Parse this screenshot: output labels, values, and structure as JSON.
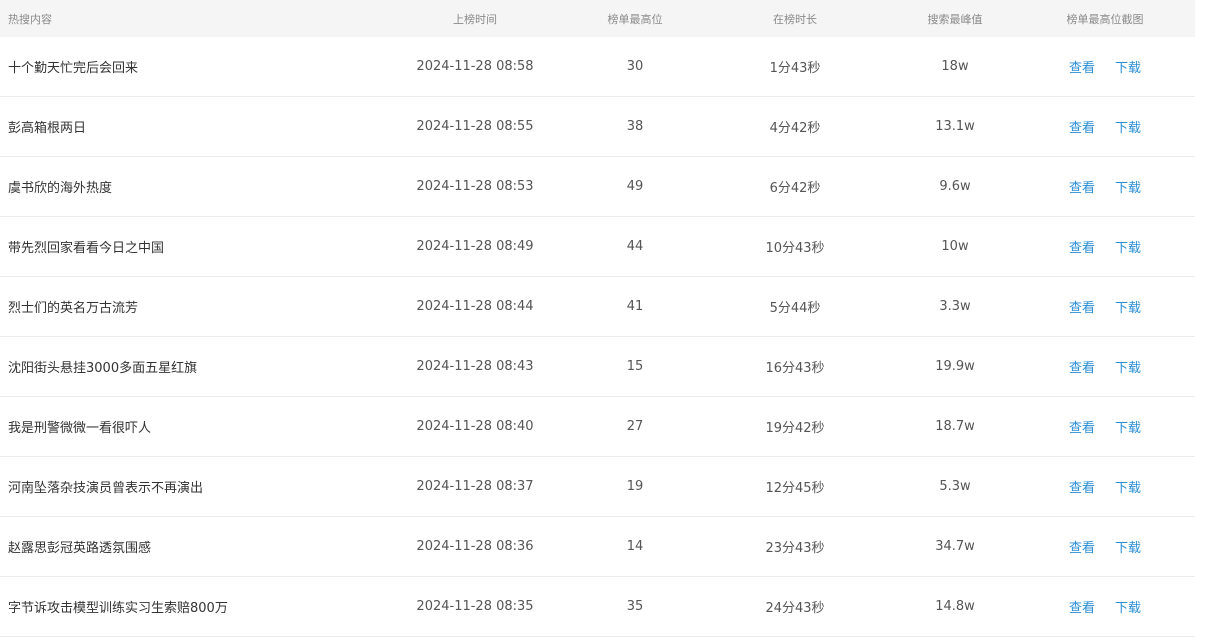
{
  "header": {
    "title": "热搜内容",
    "time": "上榜时间",
    "highest_rank": "榜单最高位",
    "duration": "在榜时长",
    "peak": "搜索最峰值",
    "screenshot": "榜单最高位截图"
  },
  "actions": {
    "view": "查看",
    "download": "下载"
  },
  "colors": {
    "link": "#2b8ed3",
    "header_bg": "#f5f5f5"
  },
  "rows": [
    {
      "title": "十个勤天忙完后会回来",
      "time": "2024-11-28 08:58",
      "rank": "30",
      "duration": "1分43秒",
      "peak": "18w"
    },
    {
      "title": "彭高箱根两日",
      "time": "2024-11-28 08:55",
      "rank": "38",
      "duration": "4分42秒",
      "peak": "13.1w"
    },
    {
      "title": "虞书欣的海外热度",
      "time": "2024-11-28 08:53",
      "rank": "49",
      "duration": "6分42秒",
      "peak": "9.6w"
    },
    {
      "title": "带先烈回家看看今日之中国",
      "time": "2024-11-28 08:49",
      "rank": "44",
      "duration": "10分43秒",
      "peak": "10w"
    },
    {
      "title": "烈士们的英名万古流芳",
      "time": "2024-11-28 08:44",
      "rank": "41",
      "duration": "5分44秒",
      "peak": "3.3w"
    },
    {
      "title": "沈阳街头悬挂3000多面五星红旗",
      "time": "2024-11-28 08:43",
      "rank": "15",
      "duration": "16分43秒",
      "peak": "19.9w"
    },
    {
      "title": "我是刑警微微一看很吓人",
      "time": "2024-11-28 08:40",
      "rank": "27",
      "duration": "19分42秒",
      "peak": "18.7w"
    },
    {
      "title": "河南坠落杂技演员曾表示不再演出",
      "time": "2024-11-28 08:37",
      "rank": "19",
      "duration": "12分45秒",
      "peak": "5.3w"
    },
    {
      "title": "赵露思彭冠英路透氛围感",
      "time": "2024-11-28 08:36",
      "rank": "14",
      "duration": "23分43秒",
      "peak": "34.7w"
    },
    {
      "title": "字节诉攻击模型训练实习生索赔800万",
      "time": "2024-11-28 08:35",
      "rank": "35",
      "duration": "24分43秒",
      "peak": "14.8w"
    }
  ]
}
